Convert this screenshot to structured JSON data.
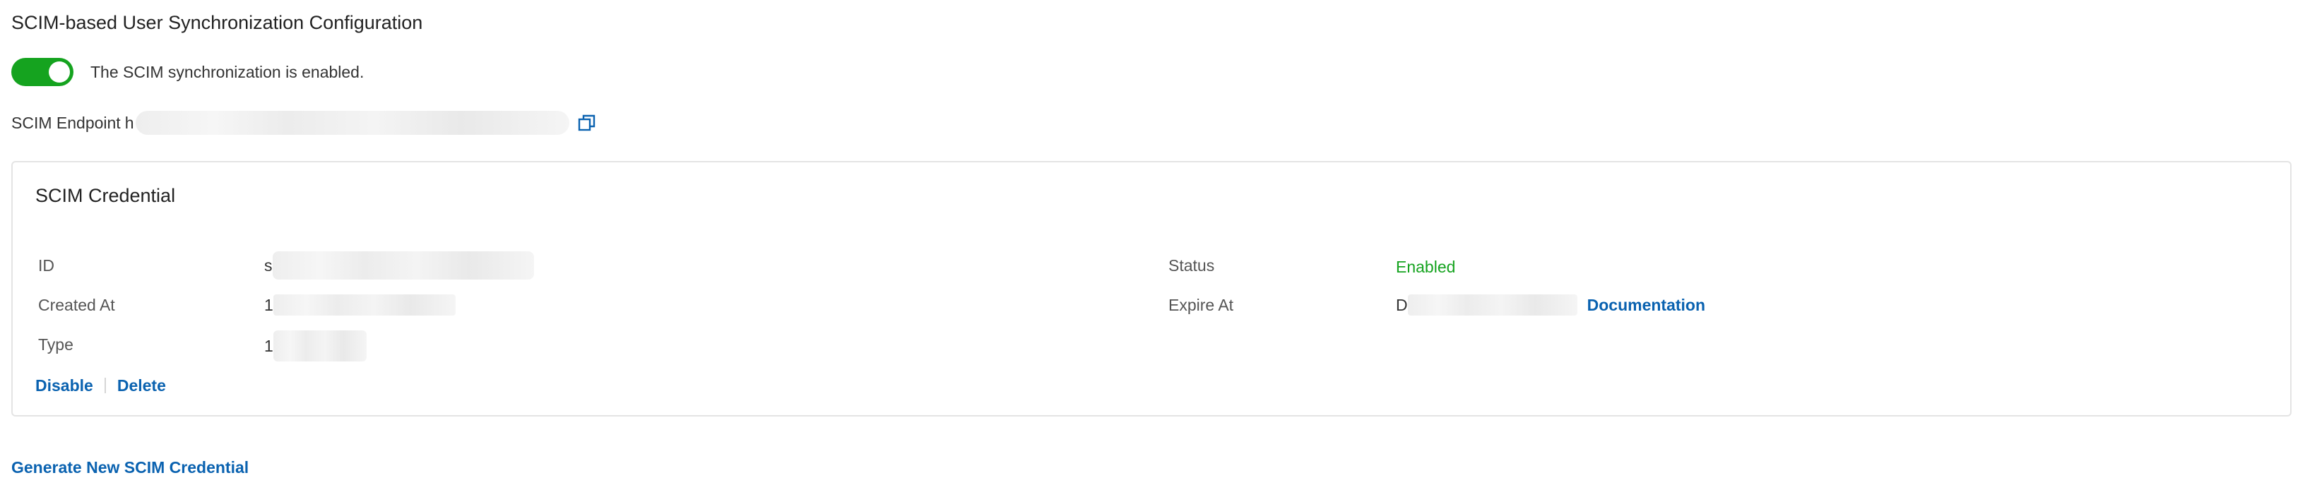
{
  "page": {
    "title": "SCIM-based User Synchronization Configuration"
  },
  "sync": {
    "enabled": true,
    "status_text": "The SCIM synchronization is enabled."
  },
  "endpoint": {
    "label": "SCIM Endpoint",
    "value_visible": "h",
    "copy_icon": "copy-icon"
  },
  "credential": {
    "title": "SCIM Credential",
    "fields": {
      "id": {
        "label": "ID",
        "value_visible": "s"
      },
      "created_at": {
        "label": "Created At",
        "value_visible": "1"
      },
      "type": {
        "label": "Type",
        "value_visible": "1"
      },
      "status": {
        "label": "Status",
        "value": "Enabled"
      },
      "expire_at": {
        "label": "Expire At",
        "value_visible": "D",
        "link": "Documentation"
      }
    },
    "actions": {
      "disable": "Disable",
      "delete": "Delete"
    }
  },
  "generate_link": "Generate New SCIM Credential",
  "colors": {
    "accent": "#0a62b0",
    "success": "#15a31f",
    "toggle_on": "#15a31f",
    "border": "#e4e4e4"
  }
}
